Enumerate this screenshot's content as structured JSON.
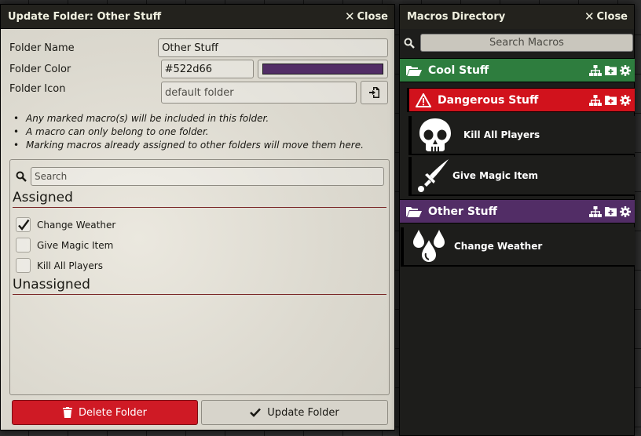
{
  "dialog": {
    "title": "Update Folder: Other Stuff",
    "close_label": "Close",
    "folder_name_label": "Folder Name",
    "folder_name_value": "Other Stuff",
    "folder_color_label": "Folder Color",
    "folder_color_value": "#522d66",
    "folder_icon_label": "Folder Icon",
    "folder_icon_placeholder": "default folder",
    "notes": [
      "Any marked macro(s) will be included in this folder.",
      "A macro can only belong to one folder.",
      "Marking macros already assigned to other folders will move them here."
    ],
    "search_placeholder": "Search",
    "assigned_heading": "Assigned",
    "assigned_items": [
      {
        "label": "Change Weather",
        "checked": true
      },
      {
        "label": "Give Magic Item",
        "checked": false
      },
      {
        "label": "Kill All Players",
        "checked": false
      }
    ],
    "unassigned_heading": "Unassigned",
    "delete_label": "Delete Folder",
    "update_label": "Update Folder"
  },
  "directory": {
    "title": "Macros Directory",
    "close_label": "Close",
    "search_placeholder": "Search Macros",
    "folders": {
      "cool": {
        "name": "Cool Stuff",
        "color": "#2e7d3e"
      },
      "dangerous": {
        "name": "Dangerous Stuff",
        "color": "#d1121c"
      },
      "other": {
        "name": "Other Stuff",
        "color": "#522d66"
      }
    },
    "macros": {
      "kill": "Kill All Players",
      "give": "Give Magic Item",
      "weather": "Change Weather"
    }
  },
  "icons": [
    "close-icon",
    "file-picker-icon",
    "search-icon",
    "check-icon",
    "trash-icon",
    "folder-open-icon",
    "warning-icon",
    "sitemap-icon",
    "folder-plus-icon",
    "gear-icon",
    "skull-icon",
    "dagger-icon",
    "water-drops-icon"
  ]
}
